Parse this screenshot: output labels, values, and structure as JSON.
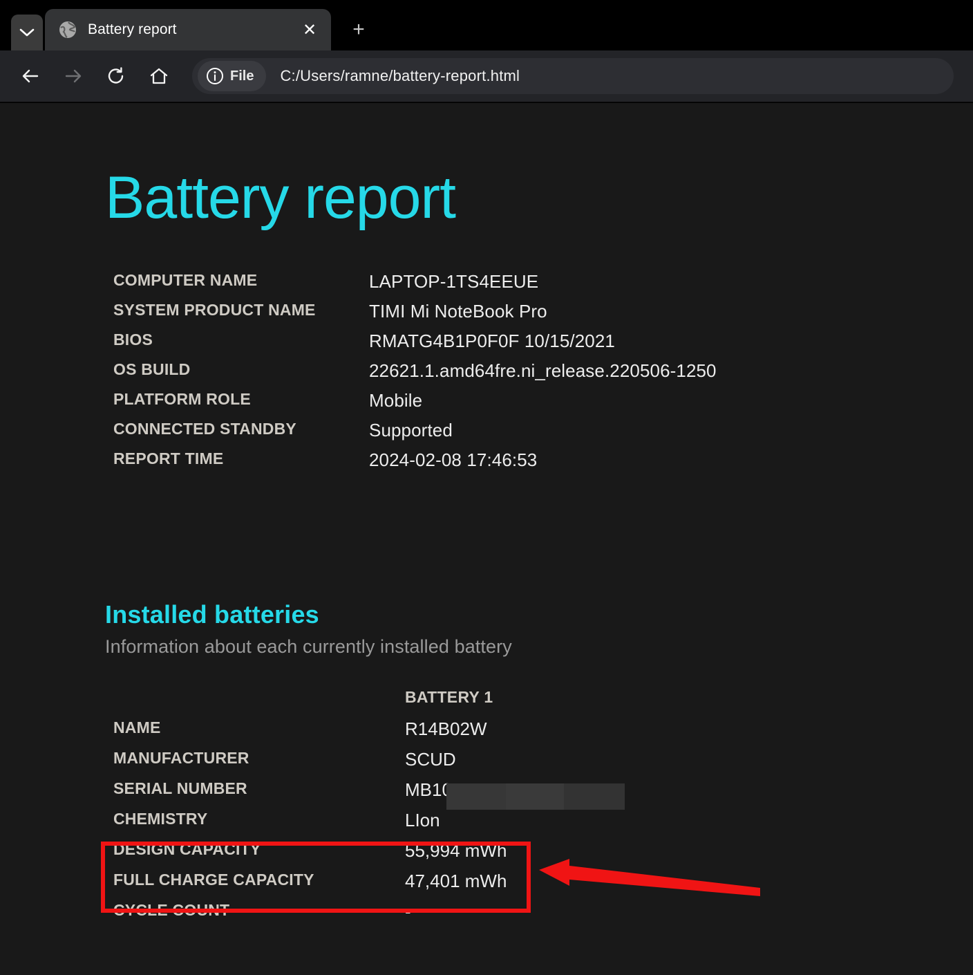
{
  "browser": {
    "tab_list_icon": "chevron-down-icon",
    "tab": {
      "favicon": "globe-icon",
      "title": "Battery report",
      "close_label": "✕"
    },
    "new_tab_label": "+",
    "nav": {
      "back": "back-arrow-icon",
      "forward": "forward-arrow-icon",
      "reload": "reload-icon",
      "home": "home-icon"
    },
    "omnibox": {
      "scheme_icon": "info-circle-icon",
      "scheme_label": "File",
      "url": "C:/Users/ramne/battery-report.html"
    }
  },
  "report": {
    "title": "Battery report",
    "system_info": [
      {
        "label": "COMPUTER NAME",
        "value": "LAPTOP-1TS4EEUE"
      },
      {
        "label": "SYSTEM PRODUCT NAME",
        "value": "TIMI Mi NoteBook Pro"
      },
      {
        "label": "BIOS",
        "value": "RMATG4B1P0F0F 10/15/2021"
      },
      {
        "label": "OS BUILD",
        "value": "22621.1.amd64fre.ni_release.220506-1250"
      },
      {
        "label": "PLATFORM ROLE",
        "value": "Mobile"
      },
      {
        "label": "CONNECTED STANDBY",
        "value": "Supported"
      },
      {
        "label": "REPORT TIME",
        "value": "2024-02-08  17:46:53"
      }
    ],
    "installed_batteries": {
      "heading": "Installed batteries",
      "subheading": "Information about each currently installed battery",
      "column_header": "BATTERY 1",
      "rows": [
        {
          "label": "NAME",
          "value": "R14B02W"
        },
        {
          "label": "MANUFACTURER",
          "value": "SCUD"
        },
        {
          "label": "SERIAL NUMBER",
          "value": "MB10"
        },
        {
          "label": "CHEMISTRY",
          "value": "LIon"
        },
        {
          "label": "DESIGN CAPACITY",
          "value": "55,994 mWh"
        },
        {
          "label": "FULL CHARGE CAPACITY",
          "value": "47,401 mWh"
        },
        {
          "label": "CYCLE COUNT",
          "value": "-"
        }
      ]
    }
  },
  "annotations": {
    "highlight_color": "#f01414",
    "highlight_box": "design-and-full-charge-capacity",
    "arrow": "points-left-to-highlight-box"
  },
  "colors": {
    "accent_cyan": "#26d9e8",
    "page_background": "#191919",
    "toolbar_background": "#232428",
    "tabstrip_background": "#000000",
    "label_text": "#cfcbc4",
    "value_text": "#ededed",
    "subheading_text": "#9a9a9a"
  }
}
